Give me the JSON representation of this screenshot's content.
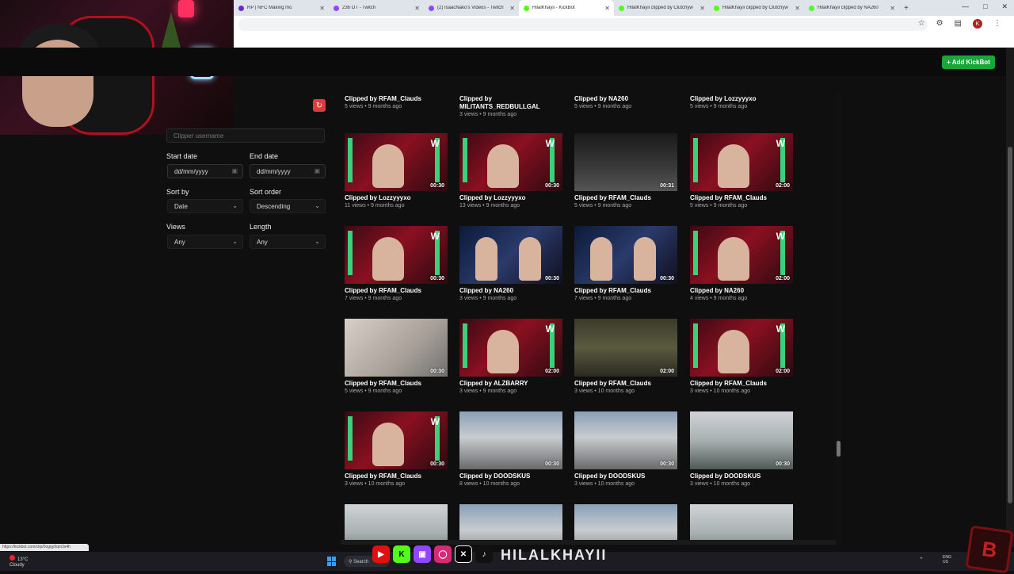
{
  "browser": {
    "tabs": [
      {
        "title": "RP | NFC Making mo",
        "color": "#6a2bd4"
      },
      {
        "title": "236 OT - Twitch",
        "color": "#9146ff"
      },
      {
        "title": "(2) IsaacNako's Videos - Twitch",
        "color": "#9146ff"
      },
      {
        "title": "HilalKhayii - KickBot",
        "color": "#53fc18",
        "active": true
      },
      {
        "title": "HilalKhayii clipped by Clutchyw",
        "color": "#53fc18"
      },
      {
        "title": "HilalKhayii clipped by Clutchyw",
        "color": "#53fc18"
      },
      {
        "title": "HilalKhayii clipped by NA260",
        "color": "#53fc18"
      }
    ],
    "new_tab": "+",
    "profile_initial": "K",
    "status_url": "https://kickbot.com/clip/0ogqy9qm3s4h"
  },
  "header": {
    "add_bot_label": "+ Add KickBot",
    "accent": "#19a63a"
  },
  "filters": {
    "clipper_placeholder": "Clipper username",
    "start_date_label": "Start date",
    "start_date_value": "dd/mm/yyyy",
    "end_date_label": "End date",
    "end_date_value": "dd/mm/yyyy",
    "sort_by_label": "Sort by",
    "sort_by_value": "Date",
    "sort_order_label": "Sort order",
    "sort_order_value": "Descending",
    "views_label": "Views",
    "views_value": "Any",
    "length_label": "Length",
    "length_value": "Any"
  },
  "top_row": [
    {
      "clipper": "Clipped by RFAM_Clauds",
      "meta": "5 views • 9 months ago"
    },
    {
      "clipper": "Clipped by MILITANTS_REDBULLGAL",
      "meta": "3 views • 9 months ago"
    },
    {
      "clipper": "Clipped by NA260",
      "meta": "5 views • 9 months ago"
    },
    {
      "clipper": "Clipped by Lozzyyyxo",
      "meta": "5 views • 9 months ago"
    }
  ],
  "clips": [
    {
      "clipper": "Clipped by Lozzyyyxo",
      "meta": "11 views • 9 months ago",
      "duration": "00:30",
      "scene": "stream"
    },
    {
      "clipper": "Clipped by Lozzyyyxo",
      "meta": "13 views • 9 months ago",
      "duration": "00:30",
      "scene": "stream"
    },
    {
      "clipper": "Clipped by RFAM_Clauds",
      "meta": "5 views • 9 months ago",
      "duration": "00:31",
      "scene": "night"
    },
    {
      "clipper": "Clipped by RFAM_Clauds",
      "meta": "5 views • 9 months ago",
      "duration": "02:00",
      "scene": "stream"
    },
    {
      "clipper": "Clipped by RFAM_Clauds",
      "meta": "7 views • 9 months ago",
      "duration": "00:30",
      "scene": "stream"
    },
    {
      "clipper": "Clipped by NA260",
      "meta": "3 views • 9 months ago",
      "duration": "00:30",
      "scene": "group"
    },
    {
      "clipper": "Clipped by RFAM_Clauds",
      "meta": "7 views • 9 months ago",
      "duration": "00:30",
      "scene": "group"
    },
    {
      "clipper": "Clipped by NA260",
      "meta": "4 views • 9 months ago",
      "duration": "02:00",
      "scene": "stream"
    },
    {
      "clipper": "Clipped by RFAM_Clauds",
      "meta": "5 views • 9 months ago",
      "duration": "00:30",
      "scene": "room"
    },
    {
      "clipper": "Clipped by ALZBARRY",
      "meta": "3 views • 9 months ago",
      "duration": "02:00",
      "scene": "stream"
    },
    {
      "clipper": "Clipped by RFAM_Clauds",
      "meta": "3 views • 10 months ago",
      "duration": "02:00",
      "scene": "street"
    },
    {
      "clipper": "Clipped by RFAM_Clauds",
      "meta": "3 views • 10 months ago",
      "duration": "02:00",
      "scene": "stream"
    },
    {
      "clipper": "Clipped by RFAM_Clauds",
      "meta": "3 views • 10 months ago",
      "duration": "00:30",
      "scene": "stream"
    },
    {
      "clipper": "Clipped by DOODSKUS",
      "meta": "8 views • 10 months ago",
      "duration": "00:30",
      "scene": "city"
    },
    {
      "clipper": "Clipped by DOODSKUS",
      "meta": "3 views • 10 months ago",
      "duration": "00:30",
      "scene": "city"
    },
    {
      "clipper": "Clipped by DOODSKUS",
      "meta": "3 views • 10 months ago",
      "duration": "00:30",
      "scene": "interior"
    },
    {
      "clipper": "",
      "meta": "",
      "duration": "",
      "scene": "interior"
    },
    {
      "clipper": "",
      "meta": "",
      "duration": "",
      "scene": "city"
    },
    {
      "clipper": "",
      "meta": "",
      "duration": "",
      "scene": "city"
    },
    {
      "clipper": "",
      "meta": "",
      "duration": "",
      "scene": "interior"
    }
  ],
  "taskbar": {
    "weather_temp": "13°C",
    "weather_text": "Cloudy",
    "weather_badge": "1",
    "search_label": "Search",
    "brand_text": "HILALKHAYII",
    "lang_top": "ENG",
    "lang_bottom": "US",
    "social_icons": [
      "youtube-icon",
      "kick-icon",
      "twitch-icon",
      "instagram-icon",
      "x-icon",
      "tiktok-icon"
    ]
  }
}
